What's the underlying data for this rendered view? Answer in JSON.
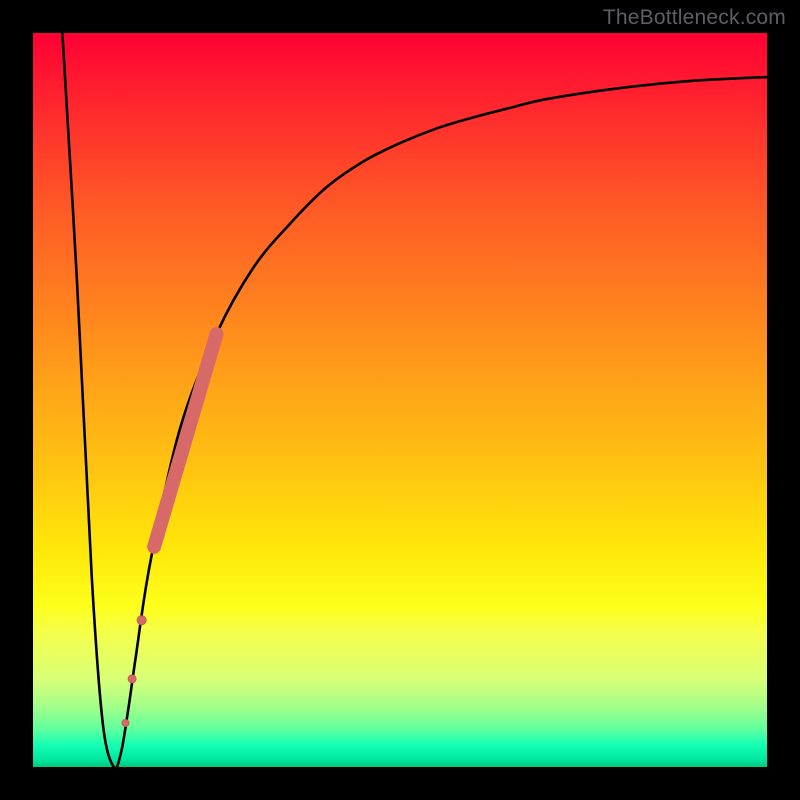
{
  "watermark": "TheBottleneck.com",
  "chart_data": {
    "type": "line",
    "title": "",
    "xlabel": "",
    "ylabel": "",
    "xlim": [
      0,
      100
    ],
    "ylim": [
      0,
      100
    ],
    "curve": {
      "x": [
        4,
        6,
        8,
        9.5,
        11,
        12,
        13,
        14,
        16,
        20,
        25,
        30,
        35,
        40,
        45,
        50,
        55,
        60,
        65,
        70,
        80,
        90,
        100
      ],
      "y": [
        100,
        66,
        26,
        6,
        0,
        2,
        8,
        15,
        28,
        46,
        59,
        68,
        74,
        79,
        82.5,
        85,
        87,
        88.5,
        89.8,
        91,
        92.5,
        93.5,
        94
      ]
    },
    "highlight_segment": {
      "x": [
        16.5,
        25.0
      ],
      "y": [
        30.0,
        59.0
      ]
    },
    "highlight_dots": [
      {
        "x": 14.8,
        "y": 20.0,
        "r": 4.5
      },
      {
        "x": 13.5,
        "y": 12.0,
        "r": 4.0
      },
      {
        "x": 12.6,
        "y": 6.0,
        "r": 3.5
      }
    ]
  },
  "colors": {
    "gradient_top": "#ff0033",
    "gradient_bottom": "#00c97f",
    "curve": "#000000",
    "highlight": "#d76a68",
    "frame": "#000000"
  }
}
